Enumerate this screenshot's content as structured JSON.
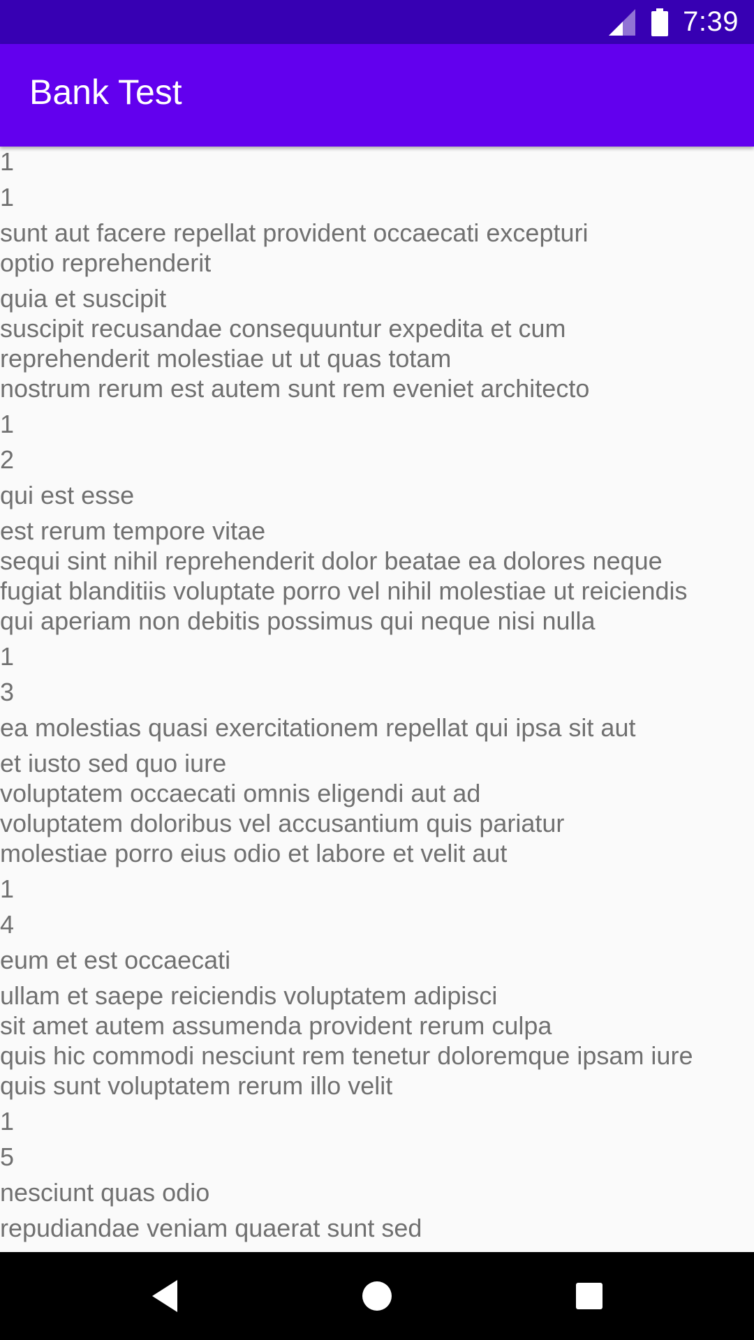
{
  "status_bar": {
    "time": "7:39",
    "icons": [
      "cell-signal-icon",
      "battery-icon"
    ]
  },
  "app_bar": {
    "title": "Bank Test"
  },
  "posts": [
    {
      "user_id": "1",
      "id": "1",
      "title": "sunt aut facere repellat provident occaecati excepturi\noptio reprehenderit",
      "body": "quia et suscipit\nsuscipit recusandae consequuntur expedita et cum\nreprehenderit molestiae ut ut quas totam\nnostrum rerum est autem sunt rem eveniet architecto"
    },
    {
      "user_id": "1",
      "id": "2",
      "title": "qui est esse",
      "body": "est rerum tempore vitae\nsequi sint nihil reprehenderit dolor beatae ea dolores neque\nfugiat blanditiis voluptate porro vel nihil molestiae ut reiciendis\nqui aperiam non debitis possimus qui neque nisi nulla"
    },
    {
      "user_id": "1",
      "id": "3",
      "title": "ea molestias quasi exercitationem repellat qui ipsa sit aut",
      "body": "et iusto sed quo iure\nvoluptatem occaecati omnis eligendi aut ad\nvoluptatem doloribus vel accusantium quis pariatur\nmolestiae porro eius odio et labore et velit aut"
    },
    {
      "user_id": "1",
      "id": "4",
      "title": "eum et est occaecati",
      "body": "ullam et saepe reiciendis voluptatem adipisci\nsit amet autem assumenda provident rerum culpa\nquis hic commodi nesciunt rem tenetur doloremque ipsam iure\nquis sunt voluptatem rerum illo velit"
    },
    {
      "user_id": "1",
      "id": "5",
      "title": "nesciunt quas odio",
      "body": "repudiandae veniam quaerat sunt sed"
    }
  ],
  "nav_bar": {
    "buttons": [
      "back-icon",
      "home-icon",
      "recents-icon"
    ]
  },
  "colors": {
    "status_bar": "#3700b3",
    "app_bar": "#6200ee",
    "text": "#707070",
    "background": "#fafafa"
  }
}
